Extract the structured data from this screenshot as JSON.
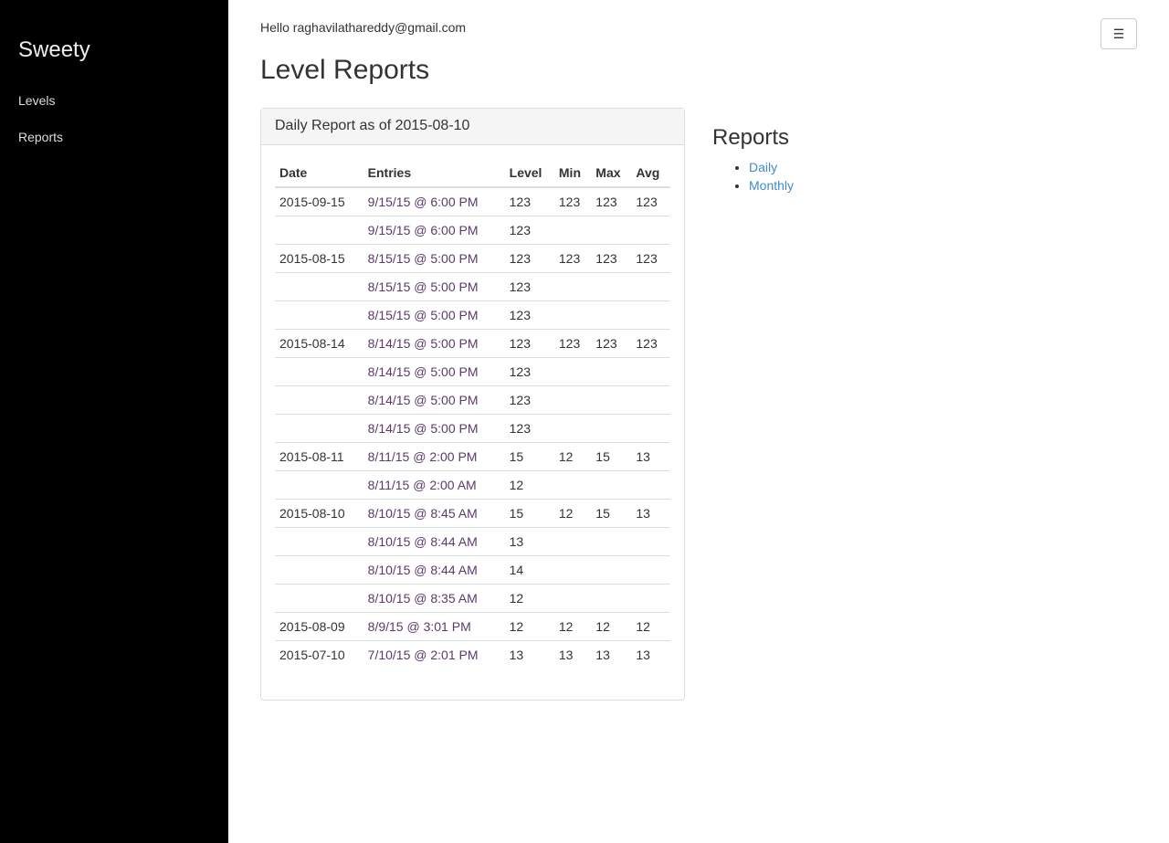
{
  "sidebar": {
    "brand": "Sweety",
    "items": [
      {
        "label": "Levels"
      },
      {
        "label": "Reports"
      }
    ]
  },
  "header": {
    "greeting": "Hello raghavilathareddy@gmail.com",
    "title": "Level Reports",
    "menu_icon": "hamburger-icon"
  },
  "panel": {
    "title": "Daily Report as of 2015-08-10",
    "columns": [
      "Date",
      "Entries",
      "Level",
      "Min",
      "Max",
      "Avg"
    ],
    "rows": [
      [
        "2015-09-15",
        "9/15/15 @ 6:00 PM",
        "123",
        "123",
        "123",
        "123"
      ],
      [
        "",
        "9/15/15 @ 6:00 PM",
        "123",
        "",
        "",
        ""
      ],
      [
        "2015-08-15",
        "8/15/15 @ 5:00 PM",
        "123",
        "123",
        "123",
        "123"
      ],
      [
        "",
        "8/15/15 @ 5:00 PM",
        "123",
        "",
        "",
        ""
      ],
      [
        "",
        "8/15/15 @ 5:00 PM",
        "123",
        "",
        "",
        ""
      ],
      [
        "2015-08-14",
        "8/14/15 @ 5:00 PM",
        "123",
        "123",
        "123",
        "123"
      ],
      [
        "",
        "8/14/15 @ 5:00 PM",
        "123",
        "",
        "",
        ""
      ],
      [
        "",
        "8/14/15 @ 5:00 PM",
        "123",
        "",
        "",
        ""
      ],
      [
        "",
        "8/14/15 @ 5:00 PM",
        "123",
        "",
        "",
        ""
      ],
      [
        "2015-08-11",
        "8/11/15 @ 2:00 PM",
        "15",
        "12",
        "15",
        "13"
      ],
      [
        "",
        "8/11/15 @ 2:00 AM",
        "12",
        "",
        "",
        ""
      ],
      [
        "2015-08-10",
        "8/10/15 @ 8:45 AM",
        "15",
        "12",
        "15",
        "13"
      ],
      [
        "",
        "8/10/15 @ 8:44 AM",
        "13",
        "",
        "",
        ""
      ],
      [
        "",
        "8/10/15 @ 8:44 AM",
        "14",
        "",
        "",
        ""
      ],
      [
        "",
        "8/10/15 @ 8:35 AM",
        "12",
        "",
        "",
        ""
      ],
      [
        "2015-08-09",
        "8/9/15 @ 3:01 PM",
        "12",
        "12",
        "12",
        "12"
      ],
      [
        "2015-07-10",
        "7/10/15 @ 2:01 PM",
        "13",
        "13",
        "13",
        "13"
      ]
    ]
  },
  "reports": {
    "title": "Reports",
    "links": [
      {
        "label": "Daily"
      },
      {
        "label": "Monthly"
      }
    ]
  }
}
